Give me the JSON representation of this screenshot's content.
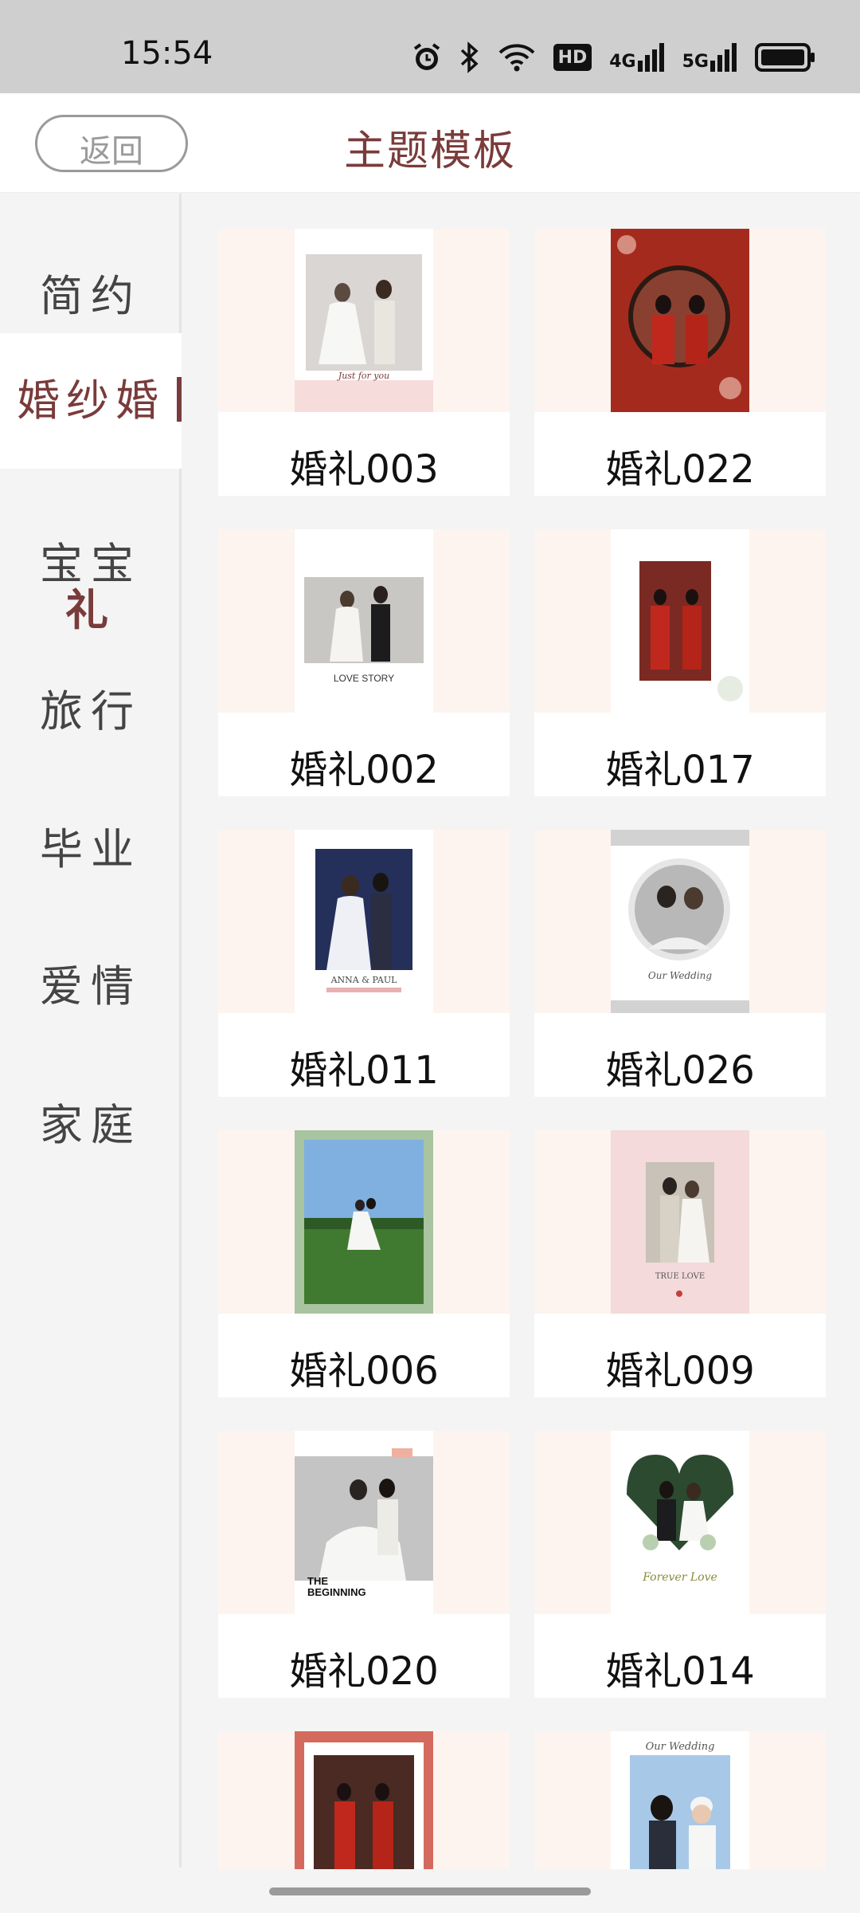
{
  "status_bar": {
    "time": "15:54",
    "icons": [
      "alarm-icon",
      "bluetooth-icon",
      "wifi-icon",
      "hd-icon",
      "signal-4g-icon",
      "signal-5g-icon",
      "battery-icon"
    ],
    "hd_label": "HD",
    "net1": "4G",
    "net2": "5G"
  },
  "header": {
    "back_label": "返回",
    "title": "主题模板"
  },
  "sidebar": {
    "items": [
      {
        "label": "简约"
      },
      {
        "label": "婚纱婚",
        "active": true
      },
      {
        "label": "宝宝",
        "label2": "礼"
      },
      {
        "label": "旅行"
      },
      {
        "label": "毕业"
      },
      {
        "label": "爱情"
      },
      {
        "label": "家庭"
      }
    ]
  },
  "templates": [
    {
      "label": "婚礼003"
    },
    {
      "label": "婚礼022"
    },
    {
      "label": "婚礼002"
    },
    {
      "label": "婚礼017"
    },
    {
      "label": "婚礼011"
    },
    {
      "label": "婚礼026"
    },
    {
      "label": "婚礼006"
    },
    {
      "label": "婚礼009"
    },
    {
      "label": "婚礼020"
    },
    {
      "label": "婚礼014"
    },
    {
      "label": ""
    },
    {
      "label": ""
    }
  ],
  "thumb_text": {
    "t003": "Just for you",
    "t002": "LOVE STORY",
    "t011": "ANNA & PAUL",
    "t026": "Our Wedding",
    "t009": "TRUE LOVE",
    "t020_a": "THE",
    "t020_b": "BEGINNING",
    "t014": "Forever Love",
    "t_last": "Our Wedding"
  },
  "colors": {
    "accent": "#7a3b3b",
    "thumb_bg": "#fdf4ef"
  }
}
